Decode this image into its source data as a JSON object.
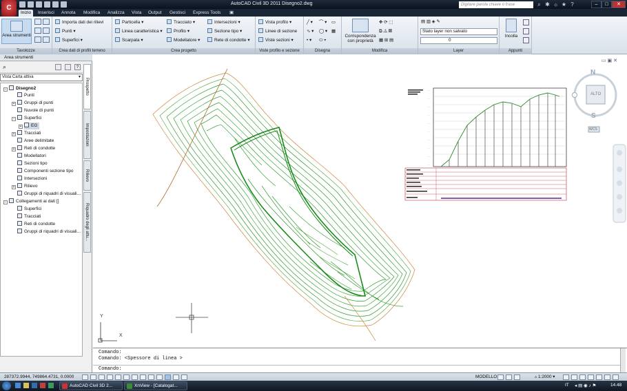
{
  "titlebar": {
    "title": "AutoCAD Civil 3D 2011   Disegno2.dwg",
    "search_placeholder": "Digitare parola chiave o frase"
  },
  "menu": {
    "tabs": [
      "Inizio",
      "Inserisci",
      "Annota",
      "Modifica",
      "Analizza",
      "Vista",
      "Output",
      "Gestisci",
      "Express Tools"
    ]
  },
  "ribbon": {
    "tavolozze": {
      "title": "Tavolozze",
      "big": "Area strumenti"
    },
    "crea_dati": {
      "title": "Crea dati di profili terreno",
      "items": [
        "Importa dati dei rilievi",
        "Punti",
        "Superfici"
      ]
    },
    "crea_progetto": {
      "title": "Crea progetto",
      "items": [
        "Particella",
        "Linea caratteristica",
        "Scarpata",
        "Tracciato",
        "Profilo",
        "Modellatore",
        "Intersezioni",
        "Sezione tipo",
        "Rete di condotte"
      ]
    },
    "viste": {
      "title": "Viste profilo e sezione",
      "items": [
        "Vista profilo",
        "Linee di sezione",
        "Viste sezioni"
      ]
    },
    "disegna": {
      "title": "Disegna"
    },
    "modifica": {
      "title": "Modifica",
      "big": "Corrispondenza con proprietà"
    },
    "layer": {
      "title": "Layer",
      "state": "Stato layer non salvato",
      "current": "0"
    },
    "appunti": {
      "title": "Appunti",
      "big": "Incolla"
    }
  },
  "palette": {
    "header": "Area strumenti",
    "view": "Vista Carta attiva",
    "tree": [
      {
        "label": "Disegno2",
        "level": 0,
        "bold": true
      },
      {
        "label": "Punti",
        "level": 2
      },
      {
        "label": "Gruppi di punti",
        "level": 2
      },
      {
        "label": "Nuvole di punti",
        "level": 2
      },
      {
        "label": "Superfici",
        "level": 2
      },
      {
        "label": "EG",
        "level": 3,
        "selected": true
      },
      {
        "label": "Tracciati",
        "level": 2
      },
      {
        "label": "Aree delimitate",
        "level": 2
      },
      {
        "label": "Reti di condotte",
        "level": 2
      },
      {
        "label": "Modellatori",
        "level": 2
      },
      {
        "label": "Sezioni tipo",
        "level": 2
      },
      {
        "label": "Componenti sezione tipo",
        "level": 2
      },
      {
        "label": "Intersezioni",
        "level": 2
      },
      {
        "label": "Rilievo",
        "level": 2
      },
      {
        "label": "Gruppi di riquadri di visuali...",
        "level": 2
      },
      {
        "label": "Collegamenti ai dati []",
        "level": 0
      },
      {
        "label": "Superfici",
        "level": 2
      },
      {
        "label": "Tracciati",
        "level": 2
      },
      {
        "label": "Reti di condotte",
        "level": 2
      },
      {
        "label": "Gruppi di riquadri di visuali...",
        "level": 2
      }
    ],
    "side_tabs": [
      "Prospetto",
      "Impostazioni",
      "Rilievo",
      "Riquadro degli attu..."
    ]
  },
  "viewcube": {
    "n": "N",
    "s": "S",
    "top": "ALTO",
    "wcs": "WCS"
  },
  "ucs": {
    "x": "X",
    "y": "Y"
  },
  "command": {
    "lines": [
      "Comando:",
      "Comando:  <Spessore di linea >"
    ],
    "prompt": "Comando:"
  },
  "status": {
    "coords": "287372.9944, 749864.4731, 0.0000",
    "model": "MODELLO",
    "scale": "1:2000"
  },
  "taskbar": {
    "items": [
      "AutoCAD Civil 3D 2...",
      "XnView - [Catalogat..."
    ],
    "lang": "IT",
    "time": "14.48"
  }
}
